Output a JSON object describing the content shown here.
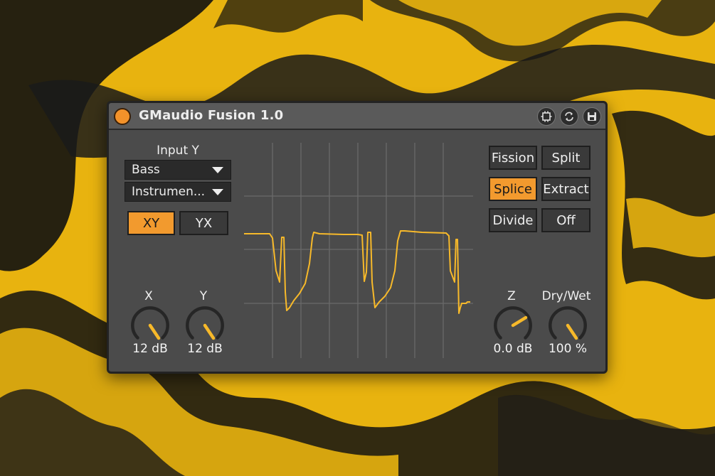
{
  "device": {
    "title": "GMaudio Fusion 1.0",
    "accent_color": "#f29a2e",
    "titlebar_icons": [
      "freeze-icon",
      "sync-icon",
      "save-icon"
    ]
  },
  "input": {
    "label": "Input Y",
    "dropdown1": "Bass",
    "dropdown2": "Instrumen...",
    "routing_buttons": [
      "XY",
      "YX"
    ],
    "routing_selected": "XY"
  },
  "modes": {
    "buttons": [
      "Fission",
      "Split",
      "Splice",
      "Extract",
      "Divide",
      "Off"
    ],
    "selected": "Splice"
  },
  "knobs": {
    "x": {
      "label": "X",
      "value": "12 dB"
    },
    "y": {
      "label": "Y",
      "value": "12 dB"
    },
    "z": {
      "label": "Z",
      "value": "0.0 dB"
    },
    "drywet": {
      "label": "Dry/Wet",
      "value": "100 %"
    }
  }
}
